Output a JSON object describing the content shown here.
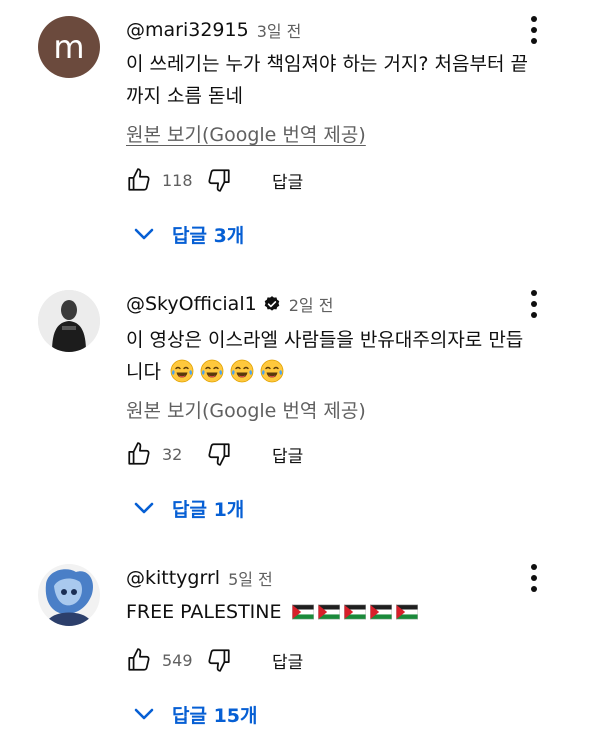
{
  "comments": [
    {
      "avatar_letter": "m",
      "avatar_color": "#6b4a3d",
      "author": "@mari32915",
      "time": "3일 전",
      "verified": false,
      "text_line1": "이 쓰레기는 누가 책임져야 하는 거지? 처음부터 끝",
      "text_line2": "까지 소름 돋네",
      "translate_label": "원본 보기(Google 번역 제공)",
      "likes": "118",
      "reply_label": "답글",
      "replies_label": "답글 3개"
    },
    {
      "author": "@SkyOfficial1",
      "time": "2일 전",
      "verified": true,
      "text_line1": "이 영상은 이스라엘 사람들을 반유대주의자로 만듭",
      "text_line2": "니다",
      "emoji_count": 4,
      "translate_label": "원본 보기(Google 번역 제공)",
      "likes": "32",
      "reply_label": "답글",
      "replies_label": "답글 1개"
    },
    {
      "author": "@kittygrrl",
      "time": "5일 전",
      "verified": false,
      "text_line1": "FREE PALESTINE",
      "flag_count": 5,
      "likes": "549",
      "reply_label": "답글",
      "replies_label": "답글 15개"
    }
  ],
  "colors": {
    "link_blue": "#065fd4",
    "secondary_text": "#606060",
    "primary_text": "#0f0f0f"
  },
  "icons": {
    "like": "thumbs-up-icon",
    "dislike": "thumbs-down-icon",
    "more": "more-vert-icon",
    "expand": "chevron-down-icon",
    "verified": "verified-badge-icon"
  }
}
